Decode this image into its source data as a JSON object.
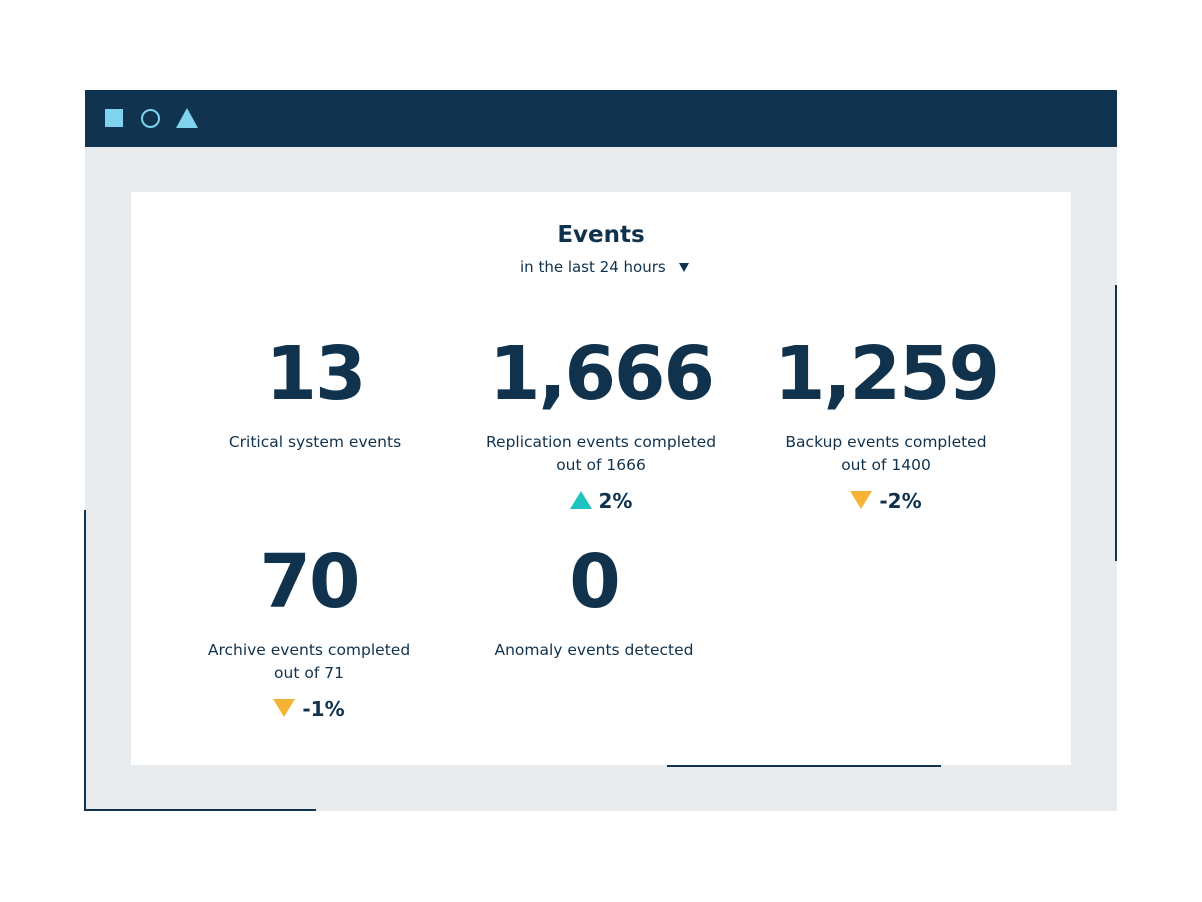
{
  "window": {
    "controls": [
      {
        "shape": "square",
        "icon": "square-icon",
        "color": "#7fd3ee"
      },
      {
        "shape": "circle",
        "icon": "circle-icon",
        "color": "#7fd3ee"
      },
      {
        "shape": "triangle",
        "icon": "triangle-icon",
        "color": "#7fd3ee"
      }
    ],
    "titlebar_color": "#10344f",
    "background_color": "#e9ecef"
  },
  "card": {
    "title": "Events",
    "range": {
      "label": "in the last 24 hours",
      "icon": "caret-down-icon"
    }
  },
  "stats": [
    {
      "value": "13",
      "label_lines": [
        "Critical system events"
      ]
    },
    {
      "value": "1,666",
      "label_lines": [
        "Replication events completed",
        "out of 1666"
      ],
      "change": {
        "text": "2%",
        "direction": "up",
        "icon": "arrow-up-icon",
        "color": "#1dc4c0"
      }
    },
    {
      "value": "1,259",
      "label_lines": [
        "Backup events completed",
        "out of 1400"
      ],
      "change": {
        "text": "-2%",
        "direction": "down",
        "icon": "arrow-down-icon",
        "color": "#f5b335"
      }
    },
    {
      "value": "70",
      "label_lines": [
        "Archive events completed",
        "out of 71"
      ],
      "change": {
        "text": "-1%",
        "direction": "down",
        "icon": "arrow-down-icon",
        "color": "#f5b335"
      }
    },
    {
      "value": "0",
      "label_lines": [
        "Anomaly events detected"
      ]
    }
  ]
}
